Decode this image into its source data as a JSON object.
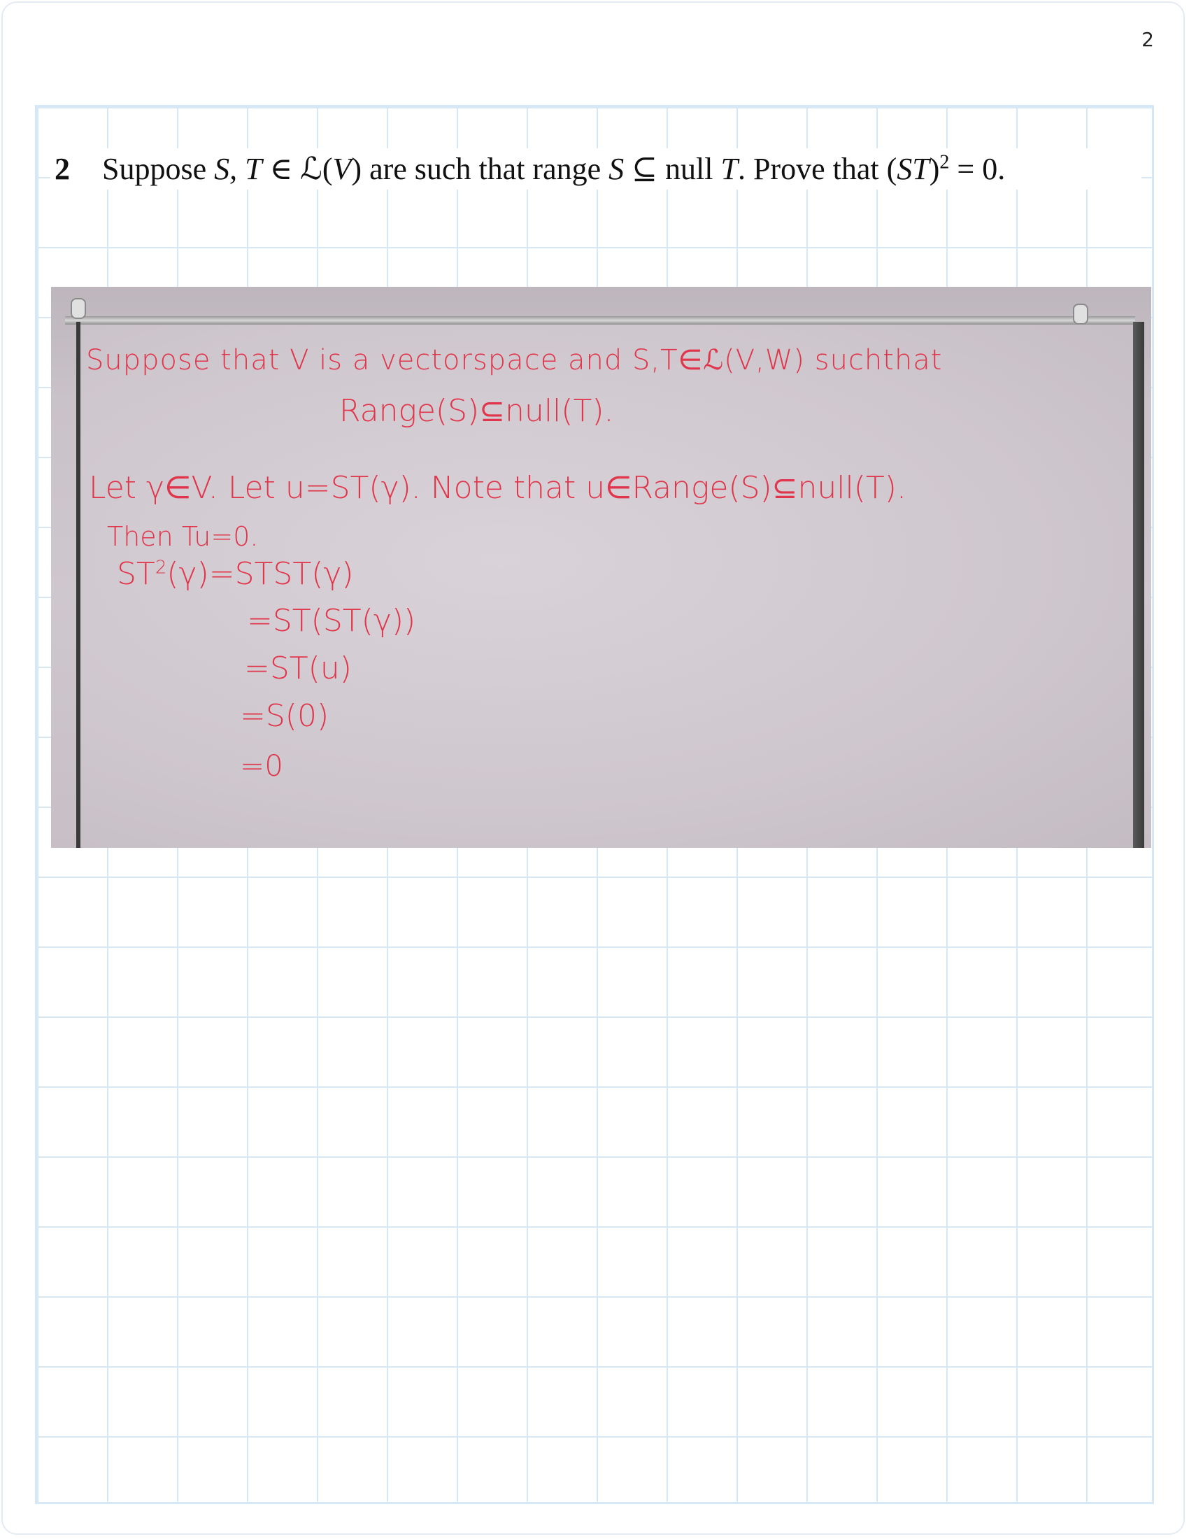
{
  "page_number": "2",
  "problem": {
    "number": "2",
    "text_1": "Suppose ",
    "vars_1": "S, T",
    "text_2": " ∈ ℒ(",
    "var_v": "V",
    "text_3": ") are such that range ",
    "var_s": "S",
    "text_4": " ⊆ null ",
    "var_t": "T",
    "text_5": ". Prove that (",
    "var_st": "ST",
    "text_6": ")",
    "exponent": "2",
    "text_7": " = 0."
  },
  "whiteboard": {
    "line_1": "Suppose that V is a vectorspace and S,T∈ℒ(V,W) suchthat",
    "line_2": "Range(S)⊆null(T).",
    "line_3": "Let γ∈V. Let u=ST(γ). Note that u∈Range(S)⊆null(T).",
    "line_4": "Then Tu=0.",
    "line_5_lhs": "ST",
    "line_5_exp": "2",
    "line_5_rhs": "(γ)=STST(γ)",
    "line_6": "=ST(ST(γ))",
    "line_7": "=ST(u)",
    "line_8": "=S(0)",
    "line_9": "=0"
  }
}
